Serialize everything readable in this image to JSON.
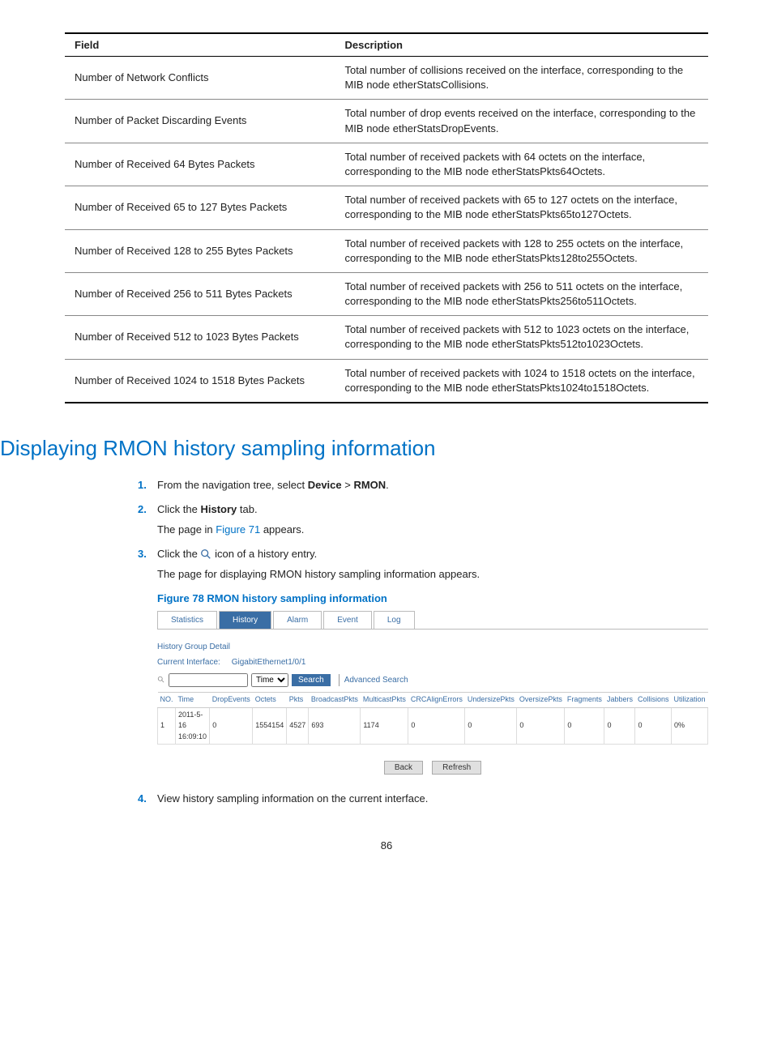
{
  "table": {
    "headers": {
      "field": "Field",
      "desc": "Description"
    },
    "rows": [
      {
        "field": "Number of Network Conflicts",
        "desc": "Total number of collisions received on the interface, corresponding to the MIB node etherStatsCollisions."
      },
      {
        "field": "Number of Packet Discarding Events",
        "desc": "Total number of drop events received on the interface, corresponding to the MIB node etherStatsDropEvents."
      },
      {
        "field": "Number of Received 64 Bytes Packets",
        "desc": "Total number of received packets with 64 octets on the interface, corresponding to the MIB node etherStatsPkts64Octets."
      },
      {
        "field": "Number of Received 65 to 127 Bytes Packets",
        "desc": "Total number of received packets with 65 to 127 octets on the interface, corresponding to the MIB node etherStatsPkts65to127Octets."
      },
      {
        "field": "Number of Received 128 to 255 Bytes Packets",
        "desc": "Total number of received packets with 128 to 255 octets on the interface, corresponding to the MIB node etherStatsPkts128to255Octets."
      },
      {
        "field": "Number of Received 256 to 511 Bytes Packets",
        "desc": "Total number of received packets with 256 to 511 octets on the interface, corresponding to the MIB node etherStatsPkts256to511Octets."
      },
      {
        "field": "Number of Received 512 to 1023 Bytes Packets",
        "desc": "Total number of received packets with 512 to 1023 octets on the interface, corresponding to the MIB node etherStatsPkts512to1023Octets."
      },
      {
        "field": "Number of Received 1024 to 1518 Bytes Packets",
        "desc": "Total number of received packets with 1024 to 1518 octets on the interface, corresponding to the MIB node etherStatsPkts1024to1518Octets."
      }
    ]
  },
  "section_title": "Displaying RMON history sampling information",
  "steps": {
    "s1_pre": "From the navigation tree, select ",
    "s1_b1": "Device",
    "s1_mid": " > ",
    "s1_b2": "RMON",
    "s1_post": ".",
    "s2_pre": "Click the ",
    "s2_b": "History",
    "s2_post": " tab.",
    "s2_sub_pre": "The page in ",
    "s2_link": "Figure 71",
    "s2_sub_post": " appears.",
    "s3_pre": "Click the ",
    "s3_post": " icon of a history entry.",
    "s3_sub": "The page for displaying RMON history sampling information appears.",
    "figcap": "Figure 78 RMON history sampling information",
    "s4": "View history sampling information on the current interface."
  },
  "figure": {
    "tabs": [
      "Statistics",
      "History",
      "Alarm",
      "Event",
      "Log"
    ],
    "active_tab": 1,
    "group_title": "History Group Detail",
    "iface_label": "Current Interface:",
    "iface_value": "GigabitEthernet1/0/1",
    "select_value": "Time",
    "search_btn": "Search",
    "adv_search": "Advanced Search",
    "cols": [
      "NO.",
      "Time",
      "DropEvents",
      "Octets",
      "Pkts",
      "BroadcastPkts",
      "MulticastPkts",
      "CRCAlignErrors",
      "UndersizePkts",
      "OversizePkts",
      "Fragments",
      "Jabbers",
      "Collisions",
      "Utilization"
    ],
    "row": [
      "1",
      "2011-5-16 16:09:10",
      "0",
      "1554154",
      "4527",
      "693",
      "1174",
      "0",
      "0",
      "0",
      "0",
      "0",
      "0",
      "0%"
    ],
    "back": "Back",
    "refresh": "Refresh"
  },
  "page_number": "86"
}
